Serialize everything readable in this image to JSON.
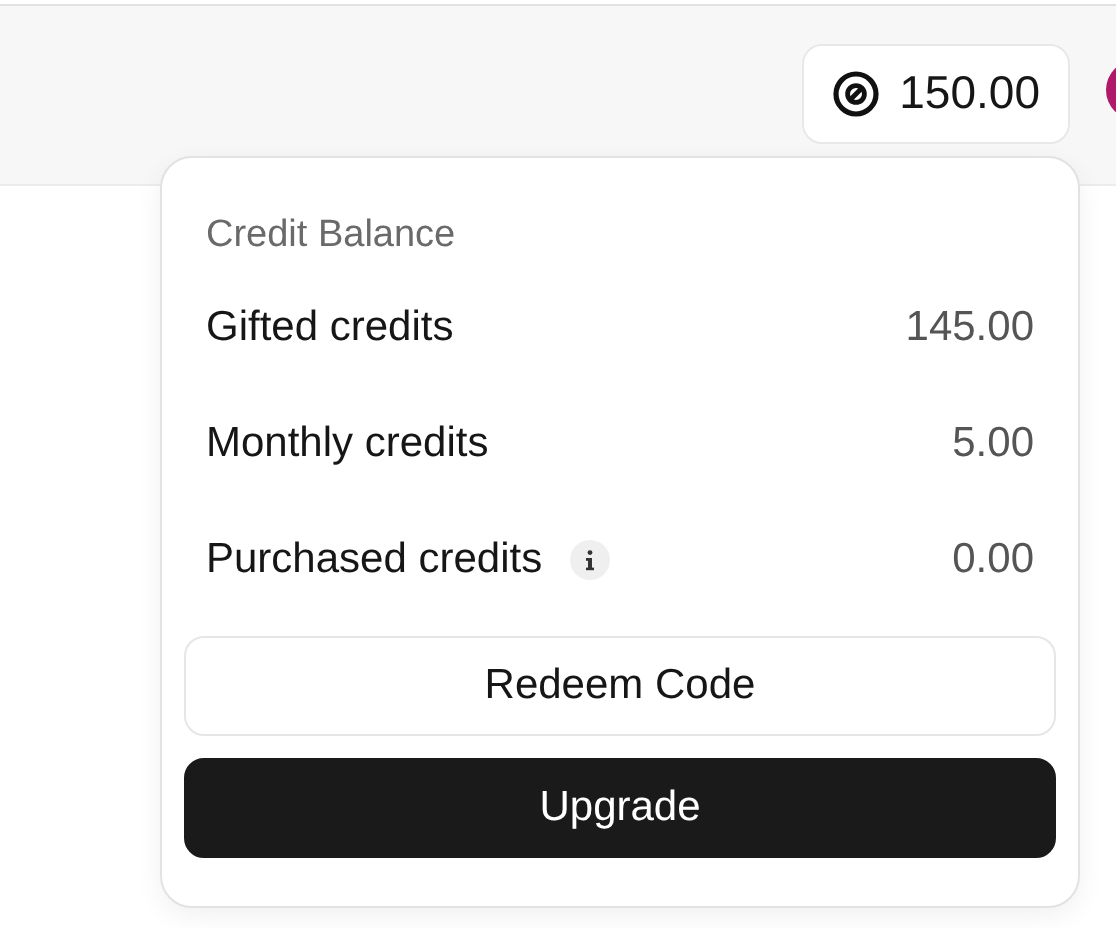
{
  "header": {
    "balance": "150.00"
  },
  "popup": {
    "title": "Credit Balance",
    "rows": [
      {
        "label": "Gifted credits",
        "value": "145.00",
        "info": false
      },
      {
        "label": "Monthly credits",
        "value": "5.00",
        "info": false
      },
      {
        "label": "Purchased credits",
        "value": "0.00",
        "info": true
      }
    ],
    "buttons": [
      {
        "label": "Redeem Code",
        "kind": "secondary"
      },
      {
        "label": "Upgrade",
        "kind": "primary"
      }
    ]
  }
}
